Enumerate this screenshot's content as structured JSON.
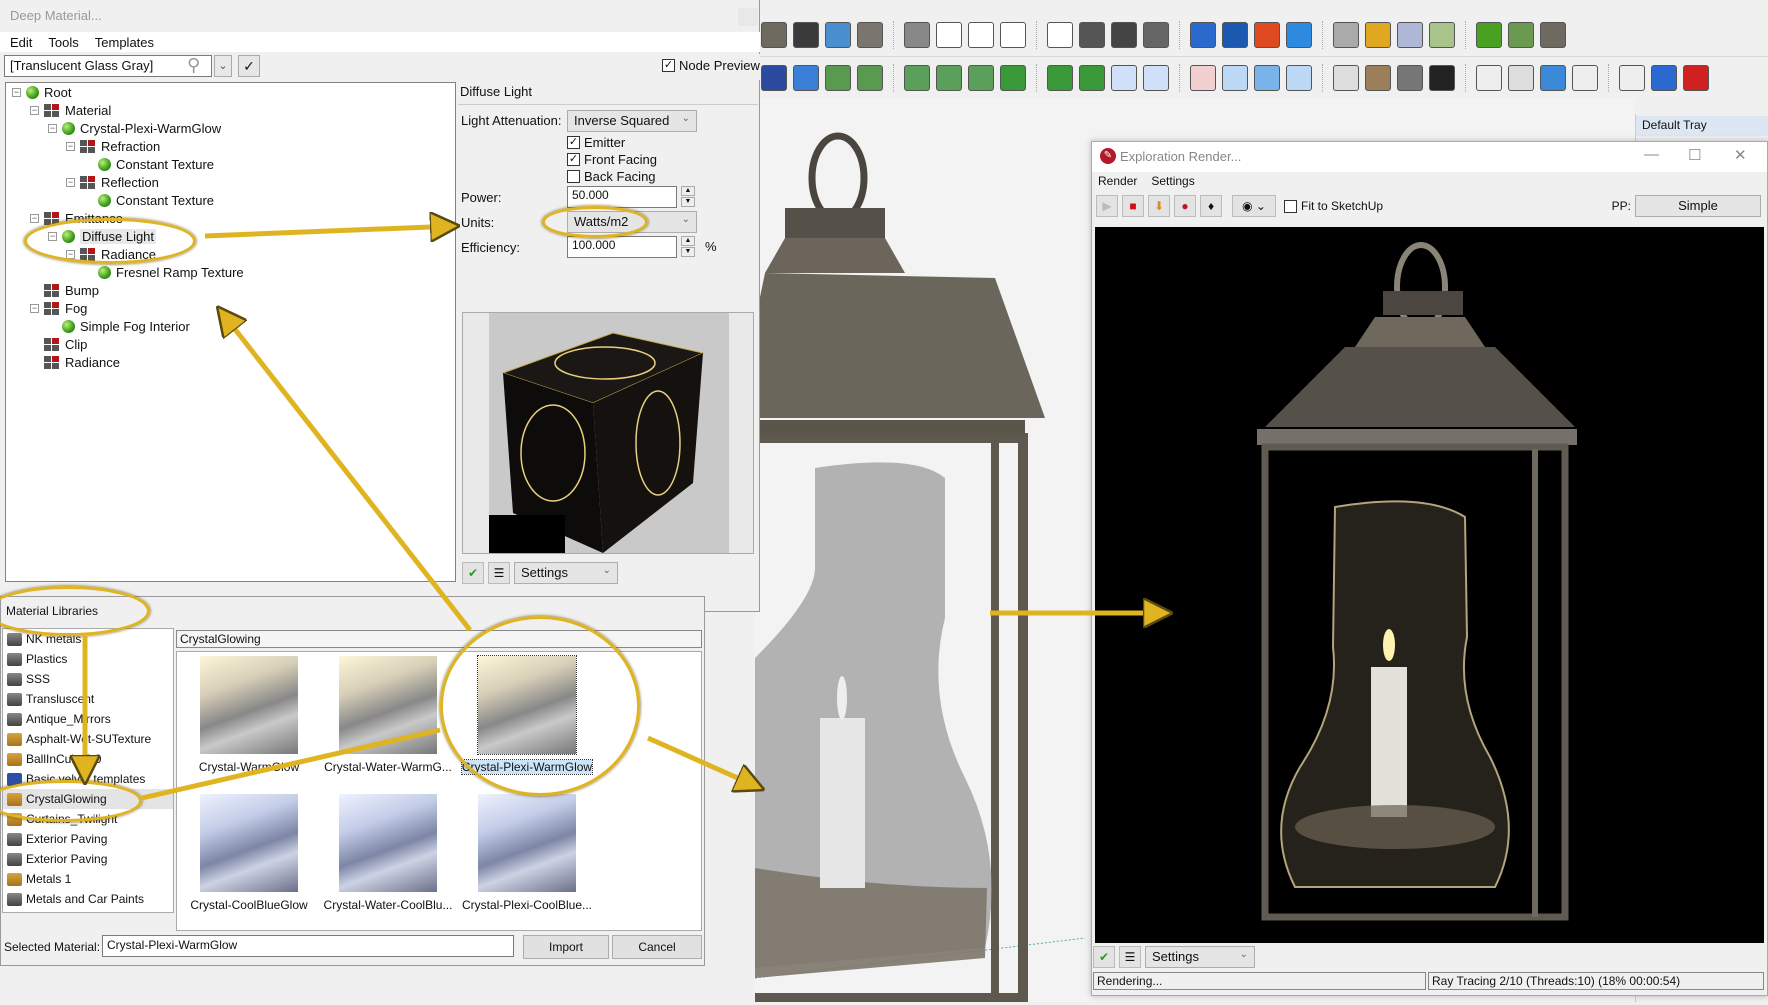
{
  "sketchup": {
    "tray_title": "Default Tray",
    "toolbar_row1_icons": [
      "style-hidden-line-icon",
      "style-shaded-icon",
      "style-textured-icon",
      "iso-view-icon",
      "top-view-icon",
      "front-view-icon",
      "right-view-icon",
      "back-view-icon",
      "left-view-icon",
      "section-plane-icon",
      "section-cut-icon",
      "section-fill-icon",
      "display-sections-icon",
      "section-blue-icon",
      "section-blue2-icon",
      "solid-red-icon",
      "solid-blue-icon",
      "solid-gray-icon",
      "solid-yellow-icon",
      "solid-split-icon",
      "solid-green-icon",
      "sandbox-icon",
      "move-3d-icon"
    ],
    "toolbar_row2_icons": [
      "binoculars-icon",
      "select-icon",
      "scale-up-icon",
      "scale-down-icon",
      "rows-icon",
      "rows-add-icon",
      "rows-remove-icon",
      "line-icon",
      "line-add-icon",
      "line-remove-icon",
      "panel-x-icon",
      "panel-x2-icon",
      "panel-x-red-icon",
      "grid-window-icon",
      "grid-window-blue-icon",
      "panel-diag-icon",
      "mesh-icon",
      "texture-icon",
      "cloud-icon",
      "checker-icon",
      "doc-icon",
      "tag-icon",
      "move-blue-icon",
      "split-v-icon",
      "split-grid-icon",
      "align-arrow-icon",
      "align-delete-icon"
    ]
  },
  "deep_material": {
    "title": "Deep Material...",
    "menu": [
      "Edit",
      "Tools",
      "Templates"
    ],
    "material_field": "[Translucent Glass Gray]",
    "node_preview_label": "Node Preview",
    "node_preview_checked": true,
    "tree": [
      {
        "label": "Root",
        "icon": "ball",
        "level": 0,
        "toggle": true
      },
      {
        "label": "Material",
        "icon": "grid",
        "level": 1,
        "toggle": true
      },
      {
        "label": "Crystal-Plexi-WarmGlow",
        "icon": "ball",
        "level": 2,
        "toggle": true
      },
      {
        "label": "Refraction",
        "icon": "grid",
        "level": 3,
        "toggle": true
      },
      {
        "label": "Constant Texture",
        "icon": "ball",
        "level": 4,
        "toggle": false
      },
      {
        "label": "Reflection",
        "icon": "grid",
        "level": 3,
        "toggle": true
      },
      {
        "label": "Constant Texture",
        "icon": "ball",
        "level": 4,
        "toggle": false
      },
      {
        "label": "Emittance",
        "icon": "grid",
        "level": 1,
        "toggle": true
      },
      {
        "label": "Diffuse Light",
        "icon": "ball",
        "level": 2,
        "toggle": true,
        "selected": true
      },
      {
        "label": "Radiance",
        "icon": "grid",
        "level": 3,
        "toggle": true
      },
      {
        "label": "Fresnel Ramp Texture",
        "icon": "ball",
        "level": 4,
        "toggle": false
      },
      {
        "label": "Bump",
        "icon": "grid",
        "level": 1,
        "toggle": false
      },
      {
        "label": "Fog",
        "icon": "grid",
        "level": 1,
        "toggle": true
      },
      {
        "label": "Simple Fog Interior",
        "icon": "ball",
        "level": 2,
        "toggle": false
      },
      {
        "label": "Clip",
        "icon": "grid",
        "level": 1,
        "toggle": false
      },
      {
        "label": "Radiance",
        "icon": "grid",
        "level": 1,
        "toggle": false
      }
    ],
    "props": {
      "heading": "Diffuse Light",
      "light_attenuation_label": "Light Attenuation:",
      "light_attenuation_value": "Inverse Squared",
      "emitter_label": "Emitter",
      "emitter_checked": true,
      "front_facing_label": "Front Facing",
      "front_facing_checked": true,
      "back_facing_label": "Back Facing",
      "back_facing_checked": false,
      "power_label": "Power:",
      "power_value": "50.000",
      "units_label": "Units:",
      "units_value": "Watts/m2",
      "efficiency_label": "Efficiency:",
      "efficiency_value": "100.000",
      "efficiency_unit": "%",
      "settings_label": "Settings"
    }
  },
  "material_libraries": {
    "title": "Material Libraries",
    "libraries": [
      {
        "label": "NK metals",
        "icon": "image"
      },
      {
        "label": "Plastics",
        "icon": "image"
      },
      {
        "label": "SSS",
        "icon": "image"
      },
      {
        "label": "Transluscent",
        "icon": "image"
      },
      {
        "label": "Antique_Mirrors",
        "icon": "image"
      },
      {
        "label": "Asphalt-Wet-SUTexture",
        "icon": "folder"
      },
      {
        "label": "BallInCube2.0",
        "icon": "folder"
      },
      {
        "label": "Basic velvet templates",
        "icon": "folder-blue"
      },
      {
        "label": "CrystalGlowing",
        "icon": "folder",
        "selected": true
      },
      {
        "label": "Curtains_Twilight",
        "icon": "folder"
      },
      {
        "label": "Exterior Paving",
        "icon": "image"
      },
      {
        "label": "Exterior Paving",
        "icon": "image"
      },
      {
        "label": "Metals 1",
        "icon": "folder"
      },
      {
        "label": "Metals and Car Paints",
        "icon": "image"
      }
    ],
    "current_path": "CrystalGlowing",
    "materials": [
      {
        "label": "Crystal-WarmGlow",
        "tone": "warm"
      },
      {
        "label": "Crystal-Water-WarmG...",
        "tone": "warm"
      },
      {
        "label": "Crystal-Plexi-WarmGlow",
        "tone": "warm",
        "selected": true
      },
      {
        "label": "Crystal-CoolBlueGlow",
        "tone": "cool"
      },
      {
        "label": "Crystal-Water-CoolBlu...",
        "tone": "cool"
      },
      {
        "label": "Crystal-Plexi-CoolBlue...",
        "tone": "cool"
      }
    ],
    "selected_material_label": "Selected Material:",
    "selected_material_value": "Crystal-Plexi-WarmGlow",
    "import_label": "Import",
    "cancel_label": "Cancel"
  },
  "render_window": {
    "title": "Exploration Render...",
    "menu": [
      "Render",
      "Settings"
    ],
    "fit_label": "Fit to SketchUp",
    "fit_checked": false,
    "pp_label": "PP:",
    "pp_value": "Simple",
    "settings_label": "Settings",
    "status_left": "Rendering...",
    "status_right": "Ray Tracing 2/10 (Threads:10) (18% 00:00:54)"
  },
  "colors": {
    "annotation": "#e0b420",
    "selection": "#cce4f7"
  }
}
